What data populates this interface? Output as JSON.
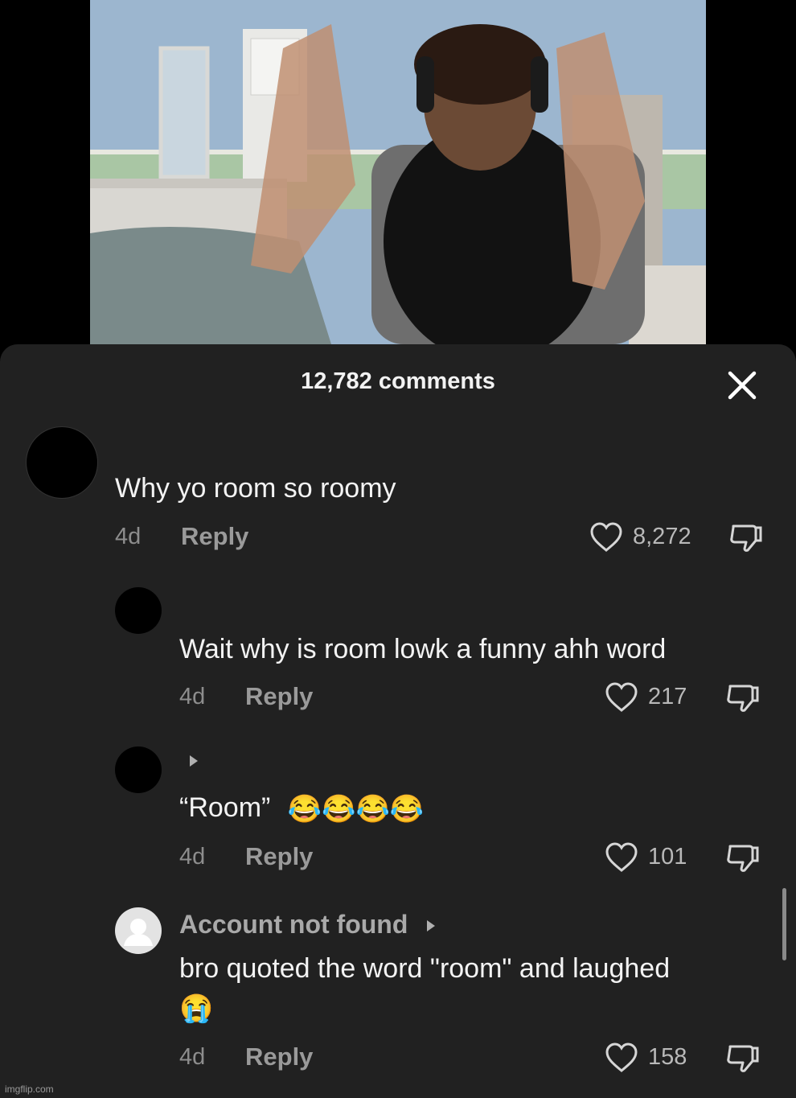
{
  "video": {
    "description_icon": "video-frame"
  },
  "comments_header": {
    "title": "12,782 comments",
    "close_icon": "close-icon"
  },
  "comments": [
    {
      "text": "Why yo room so roomy",
      "time": "4d",
      "reply_label": "Reply",
      "likes": "8,272"
    },
    {
      "text": "Wait why is room lowk a funny ahh word",
      "time": "4d",
      "reply_label": "Reply",
      "likes": "217"
    },
    {
      "text": "“Room”",
      "emojis": "😂😂😂😂",
      "time": "4d",
      "reply_label": "Reply",
      "likes": "101"
    },
    {
      "username": "Account not found",
      "text": "bro quoted the word \"room\" and laughed",
      "emoji": "😭",
      "time": "4d",
      "reply_label": "Reply",
      "likes": "158"
    }
  ],
  "watermark": "imgflip.com"
}
